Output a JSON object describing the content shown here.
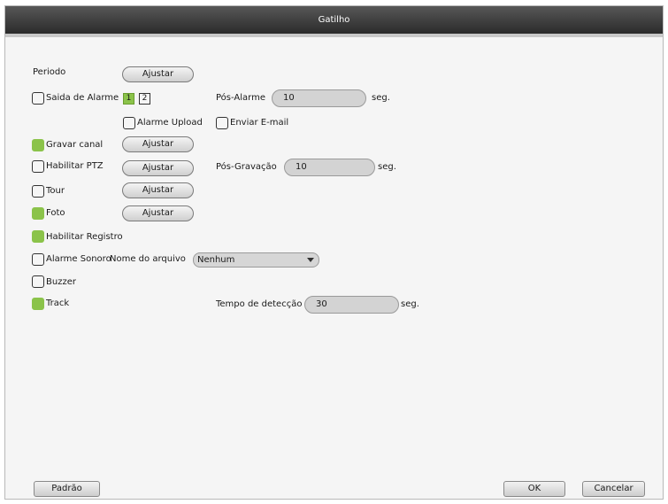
{
  "title": "Gatilho",
  "rows": {
    "periodo": {
      "label": "Periodo",
      "button": "Ajustar"
    },
    "saida_alarme": {
      "label": "Saida de Alarme",
      "checked": false,
      "channels": [
        {
          "label": "1",
          "selected": true
        },
        {
          "label": "2",
          "selected": false
        }
      ]
    },
    "pos_alarme": {
      "label": "Pós-Alarme",
      "value": "10",
      "unit": "seg."
    },
    "alarme_upload": {
      "label": "Alarme Upload",
      "checked": false
    },
    "enviar_email": {
      "label": "Enviar E-mail",
      "checked": false
    },
    "gravar_canal": {
      "label": "Gravar canal",
      "checked": true,
      "button": "Ajustar"
    },
    "habilitar_ptz": {
      "label": "Habilitar PTZ",
      "checked": false,
      "button": "Ajustar"
    },
    "pos_gravacao": {
      "label": "Pós-Gravação",
      "value": "10",
      "unit": "seg."
    },
    "tour": {
      "label": "Tour",
      "checked": false,
      "button": "Ajustar"
    },
    "foto": {
      "label": "Foto",
      "checked": true,
      "button": "Ajustar"
    },
    "habilitar_registro": {
      "label": "Habilitar Registro",
      "checked": true
    },
    "alarme_sonoro": {
      "label": "Alarme Sonoro",
      "checked": false,
      "file_label": "Nome do arquivo",
      "file_value": "Nenhum"
    },
    "buzzer": {
      "label": "Buzzer",
      "checked": false
    },
    "track": {
      "label": "Track",
      "checked": true
    },
    "tempo_deteccao": {
      "label": "Tempo de detecção",
      "value": "30",
      "unit": "seg."
    }
  },
  "footer": {
    "default_label": "Padrão",
    "ok_label": "OK",
    "cancel_label": "Cancelar"
  },
  "colors": {
    "accent": "#8bc34a",
    "titlebar": "#3a3a3a"
  }
}
